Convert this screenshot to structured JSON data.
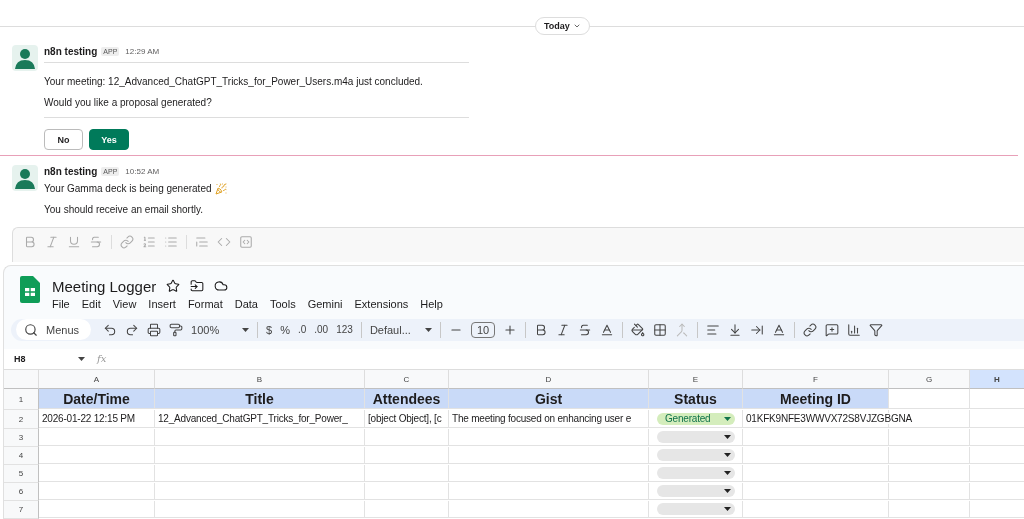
{
  "slack": {
    "date_divider": "Today",
    "messages": [
      {
        "sender": "n8n testing",
        "badge": "APP",
        "time": "12:29 AM",
        "framed": true,
        "lines": [
          {
            "kind": "plain",
            "text": "Your meeting: 12_Advanced_ChatGPT_Tricks_for_Power_Users.m4a just concluded."
          },
          {
            "kind": "plain",
            "text": "Would you like a proposal generated?"
          }
        ],
        "buttons": [
          {
            "label": "No",
            "primary": false
          },
          {
            "label": "Yes",
            "primary": true
          }
        ]
      },
      {
        "sender": "n8n testing",
        "badge": "APP",
        "time": "10:52 AM",
        "framed": false,
        "lines": [
          {
            "kind": "celebration",
            "text": "Your Gamma deck is being generated"
          },
          {
            "kind": "plain",
            "text": "You should receive an email shortly."
          }
        ]
      }
    ]
  },
  "sheet": {
    "title": "Meeting Logger",
    "menu": [
      "File",
      "Edit",
      "View",
      "Insert",
      "Format",
      "Data",
      "Tools",
      "Gemini",
      "Extensions",
      "Help"
    ],
    "toolbar": {
      "search_placeholder": "Menus",
      "zoom": "100%",
      "currency": "$",
      "percent": "%",
      "decrease_decimals": ".0",
      "increase_decimals": ".00",
      "number_format": "123",
      "font": "Defaul...",
      "font_size": "10"
    },
    "name_box": "H8",
    "formula_label": "fx",
    "columns": [
      {
        "letter": "A",
        "selected": false
      },
      {
        "letter": "B",
        "selected": false
      },
      {
        "letter": "C",
        "selected": false
      },
      {
        "letter": "D",
        "selected": false
      },
      {
        "letter": "E",
        "selected": false
      },
      {
        "letter": "F",
        "selected": false
      },
      {
        "letter": "G",
        "selected": false
      },
      {
        "letter": "H",
        "selected": true
      }
    ],
    "rows": [
      {
        "number": "1",
        "kind": "header",
        "cells": [
          "Date/Time",
          "Title",
          "Attendees",
          "Gist",
          "Status",
          "Meeting ID",
          "",
          ""
        ]
      },
      {
        "number": "2",
        "kind": "data",
        "cells": [
          "2026-01-22 12:15 PM",
          "12_Advanced_ChatGPT_Tricks_for_Power_",
          "[object Object], [c",
          "The meeting focused on enhancing user e",
          {
            "kind": "chip",
            "text": "Generated"
          },
          "01KFK9NFE3WWVX72S8VJZGBGNA",
          "",
          ""
        ]
      },
      {
        "number": "3",
        "kind": "data",
        "cells": [
          "",
          "",
          "",
          "",
          {
            "kind": "chip"
          },
          "",
          "",
          ""
        ]
      },
      {
        "number": "4",
        "kind": "data",
        "cells": [
          "",
          "",
          "",
          "",
          {
            "kind": "chip"
          },
          "",
          "",
          ""
        ]
      },
      {
        "number": "5",
        "kind": "data",
        "cells": [
          "",
          "",
          "",
          "",
          {
            "kind": "chip"
          },
          "",
          "",
          ""
        ]
      },
      {
        "number": "6",
        "kind": "data",
        "cells": [
          "",
          "",
          "",
          "",
          {
            "kind": "chip"
          },
          "",
          "",
          ""
        ]
      },
      {
        "number": "7",
        "kind": "data",
        "cells": [
          "",
          "",
          "",
          "",
          {
            "kind": "chip"
          },
          "",
          "",
          ""
        ]
      }
    ]
  }
}
